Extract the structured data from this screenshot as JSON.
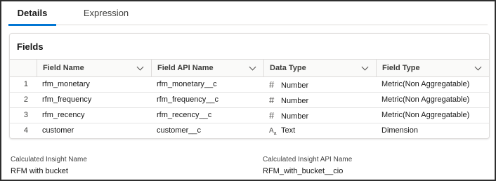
{
  "tabs": [
    {
      "label": "Details",
      "active": true
    },
    {
      "label": "Expression",
      "active": false
    }
  ],
  "fields_card": {
    "title": "Fields",
    "columns": [
      "Field Name",
      "Field API Name",
      "Data Type",
      "Field Type"
    ],
    "rows": [
      {
        "num": "1",
        "name": "rfm_monetary",
        "api": "rfm_monetary__c",
        "type_icon": "#",
        "type": "Number",
        "ftype": "Metric(Non Aggregatable)"
      },
      {
        "num": "2",
        "name": "rfm_frequency",
        "api": "rfm_frequency__c",
        "type_icon": "#",
        "type": "Number",
        "ftype": "Metric(Non Aggregatable)"
      },
      {
        "num": "3",
        "name": "rfm_recency",
        "api": "rfm_recency__c",
        "type_icon": "#",
        "type": "Number",
        "ftype": "Metric(Non Aggregatable)"
      },
      {
        "num": "4",
        "name": "customer",
        "api": "customer__c",
        "type_icon": "text",
        "type": "Text",
        "ftype": "Dimension"
      }
    ]
  },
  "insight": {
    "name_label": "Calculated Insight Name",
    "name_value": "RFM with bucket",
    "api_label": "Calculated Insight API Name",
    "api_value": "RFM_with_bucket__cio"
  },
  "colors": {
    "accent": "#0176d3",
    "border": "#dddbda"
  }
}
